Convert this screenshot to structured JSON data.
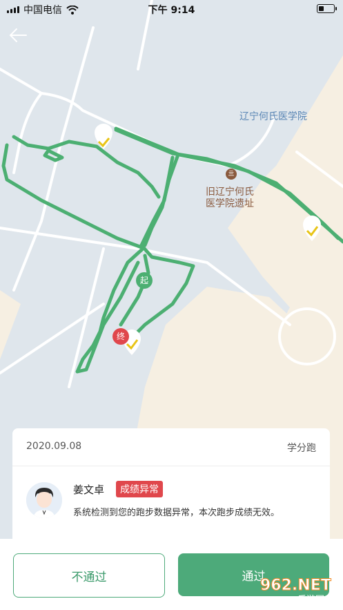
{
  "status_bar": {
    "carrier": "中国电信",
    "time": "下午 9:14",
    "battery_level": 0.35
  },
  "icons": {
    "back": "left-arrow",
    "wifi": "wifi",
    "checkpoint": "check",
    "poi": "landmark"
  },
  "colors": {
    "track": "#4caf72",
    "start_marker": "#4caf72",
    "end_marker": "#e0474c",
    "primary": "#4daa7a",
    "map_bg": "#dfe6ec",
    "land": "#f6efe2"
  },
  "map": {
    "labels": {
      "college": "辽宁何氏医学院",
      "site_line1": "旧辽宁何氏",
      "site_line2": "医学院遗址"
    },
    "poi_glyph": "亖",
    "start_label": "起",
    "end_label": "终"
  },
  "record": {
    "date": "2020.09.08",
    "type": "学分跑",
    "name": "姜文卓",
    "status": "成绩异常",
    "message": "系统检测到您的跑步数据异常，本次跑步成绩无效。"
  },
  "actions": {
    "reject": "不通过",
    "approve": "通过"
  },
  "watermark": {
    "brand": "962.NET",
    "caption": "乐游网"
  }
}
